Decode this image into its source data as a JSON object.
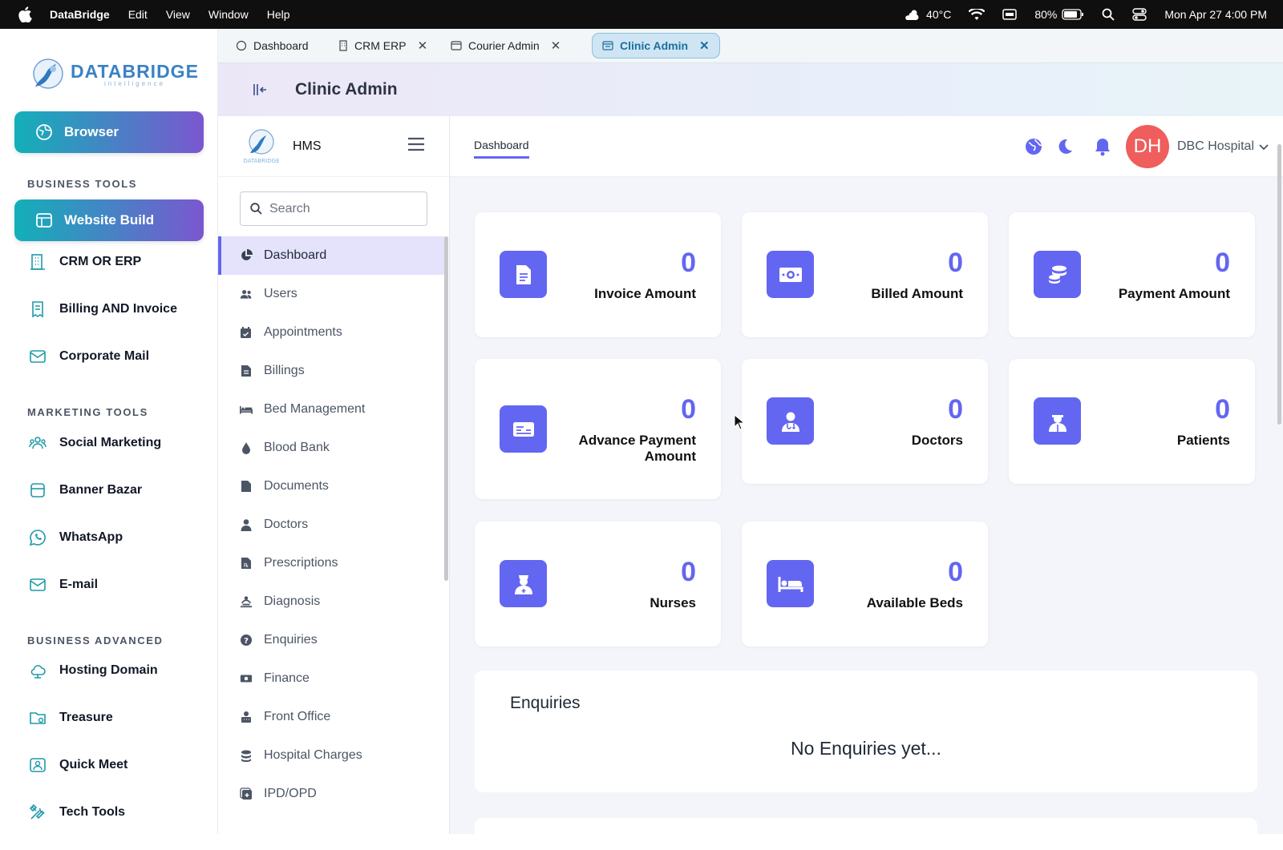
{
  "menubar": {
    "app_name": "DataBridge",
    "menus": [
      "Edit",
      "View",
      "Window",
      "Help"
    ],
    "weather": "40°C",
    "battery": "80%",
    "datetime": "Mon Apr 27  4:00 PM"
  },
  "left": {
    "logo_text": "DATABRIDGE",
    "logo_sub": "intelligence",
    "browser_btn": "Browser",
    "sections": {
      "business_tools": "BUSINESS TOOLS",
      "marketing_tools": "MARKETING TOOLS",
      "business_advanced": "BUSINESS ADVANCED"
    },
    "items": {
      "website_build": "Website Build",
      "crm": "CRM OR ERP",
      "billing": "Billing AND  Invoice",
      "mail": "Corporate Mail",
      "social": "Social Marketing",
      "banner": "Banner Bazar",
      "whatsapp": "WhatsApp",
      "email": "E-mail",
      "hosting": "Hosting Domain",
      "treasure": "Treasure",
      "meet": "Quick Meet",
      "tech": "Tech Tools"
    }
  },
  "tabs": [
    "Dashboard",
    "CRM ERP",
    "Courier Admin",
    "Clinic Admin"
  ],
  "title": "Clinic Admin",
  "hms": {
    "brand": "HMS",
    "brand_logo": "DATABRIDGE",
    "search_placeholder": "Search",
    "nav": [
      "Dashboard",
      "Users",
      "Appointments",
      "Billings",
      "Bed Management",
      "Blood Bank",
      "Documents",
      "Doctors",
      "Prescriptions",
      "Diagnosis",
      "Enquiries",
      "Finance",
      "Front Office",
      "Hospital Charges",
      "IPD/OPD"
    ],
    "topbar_tab": "Dashboard",
    "avatar_initials": "DH",
    "hospital": "DBC Hospital"
  },
  "cards": [
    {
      "value": "0",
      "label": "Invoice Amount"
    },
    {
      "value": "0",
      "label": "Billed Amount"
    },
    {
      "value": "0",
      "label": "Payment Amount"
    },
    {
      "value": "0",
      "label": "Advance Payment Amount"
    },
    {
      "value": "0",
      "label": "Doctors"
    },
    {
      "value": "0",
      "label": "Patients"
    },
    {
      "value": "0",
      "label": "Nurses"
    },
    {
      "value": "0",
      "label": "Available Beds"
    }
  ],
  "enquiries": {
    "title": "Enquiries",
    "empty": "No Enquiries yet..."
  },
  "colors": {
    "accent": "#6366f1",
    "gradient_start": "#12b0b9",
    "gradient_end": "#7a57cf",
    "avatar": "#ef5d5d"
  }
}
